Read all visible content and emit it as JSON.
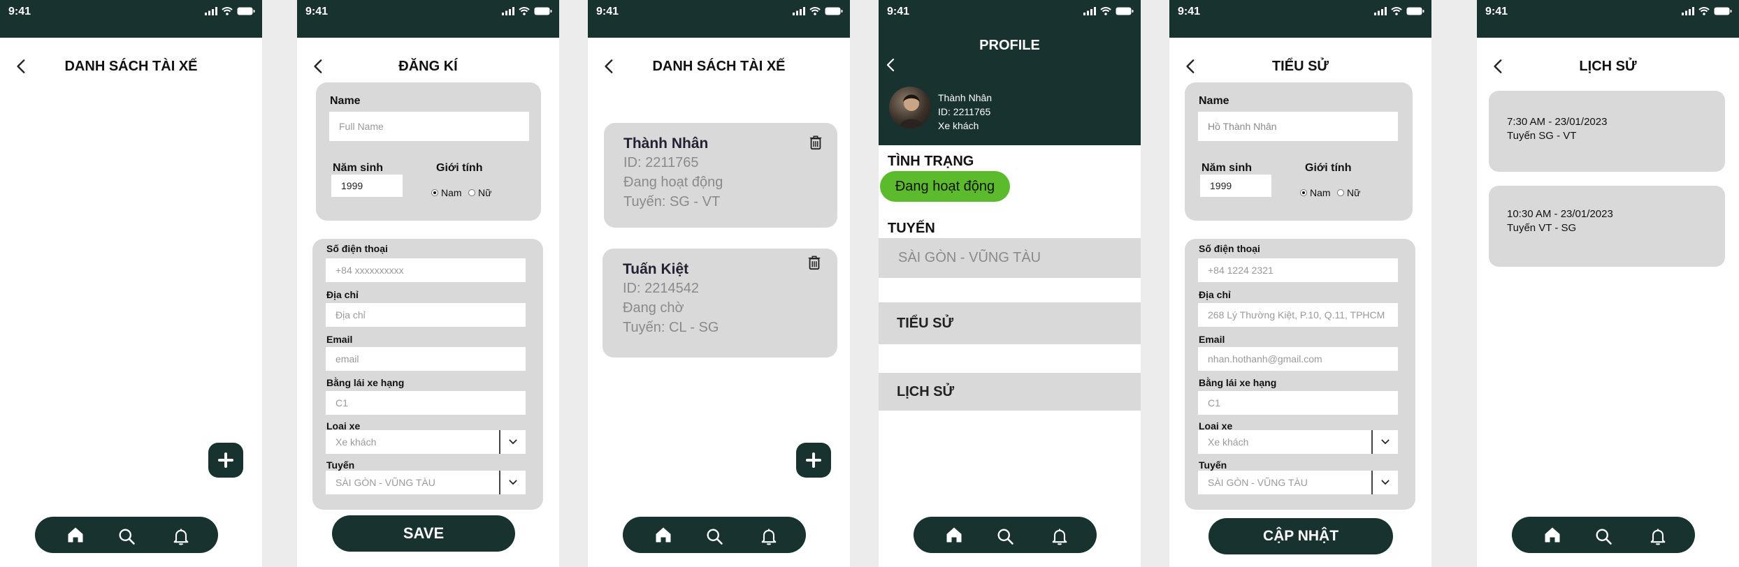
{
  "status": {
    "time": "9:41"
  },
  "screen1": {
    "title": "DANH SÁCH TÀI XẾ"
  },
  "screen2": {
    "title": "ĐĂNG KÍ",
    "name_label": "Name",
    "name_placeholder": "Full Name",
    "dob_label": "Năm sinh",
    "dob_value": "1999",
    "gender_label": "Giới tính",
    "gender_male": "Nam",
    "gender_female": "Nữ",
    "phone_label": "Số điện thoại",
    "phone_placeholder": "+84 xxxxxxxxxx",
    "address_label": "Địa chỉ",
    "address_placeholder": "Địa chỉ",
    "email_label": "Email",
    "email_placeholder": "email",
    "license_label": "Bằng lái xe hạng",
    "license_placeholder": "C1",
    "vehicle_label": "Loại xe",
    "vehicle_value": "Xe khách",
    "route_label": "Tuyến",
    "route_value": "SÀI GÒN - VŨNG TÀU",
    "save_label": "SAVE"
  },
  "screen3": {
    "title": "DANH SÁCH TÀI XẾ",
    "drivers": [
      {
        "name": "Thành Nhân",
        "id": "ID: 2211765",
        "status": "Đang hoạt động",
        "route": "Tuyến: SG - VT"
      },
      {
        "name": "Tuấn Kiệt",
        "id": "ID: 2214542",
        "status": "Đang chờ",
        "route": "Tuyến: CL - SG"
      }
    ]
  },
  "screen4": {
    "title": "PROFILE",
    "name": "Thành Nhân",
    "id": "ID: 2211765",
    "vehicle": "Xe khách",
    "status_heading": "TÌNH TRẠNG",
    "status_value": "Đang hoạt động",
    "status_color": "#5bbb2d",
    "route_heading": "TUYẾN",
    "route_value": "SÀI GÒN - VŨNG TÀU",
    "bio_label": "TIỂU SỬ",
    "history_label": "LỊCH SỬ"
  },
  "screen5": {
    "title": "TIỂU SỬ",
    "name_label": "Name",
    "name_value": "Hồ Thành Nhân",
    "dob_label": "Năm sinh",
    "dob_value": "1999",
    "gender_label": "Giới tính",
    "gender_male": "Nam",
    "gender_female": "Nữ",
    "phone_label": "Số điện thoại",
    "phone_value": "+84 1224 2321",
    "address_label": "Địa chỉ",
    "address_value": "268 Lý Thường Kiệt, P.10, Q.11, TPHCM",
    "email_label": "Email",
    "email_value": "nhan.hothanh@gmail.com",
    "license_label": "Bằng lái xe hạng",
    "license_value": "C1",
    "vehicle_label": "Loại xe",
    "vehicle_value": "Xe khách",
    "route_label": "Tuyến",
    "route_value": "SÀI GÒN - VŨNG TÀU",
    "update_label": "CẬP NHẬT"
  },
  "screen6": {
    "title": "LỊCH SỬ",
    "entries": [
      {
        "time": "7:30 AM - 23/01/2023",
        "route": "Tuyến SG - VT"
      },
      {
        "time": "10:30 AM - 23/01/2023",
        "route": "Tuyến VT - SG"
      }
    ]
  },
  "icons": {
    "back": "chevron-left-icon",
    "home": "home-icon",
    "search": "search-icon",
    "bell": "bell-icon",
    "plus": "plus-icon",
    "trash": "trash-icon",
    "dropdown": "chevron-down-icon"
  },
  "colors": {
    "primary": "#17322f",
    "panel": "#d9d9d9",
    "active": "#5bbb2d"
  }
}
